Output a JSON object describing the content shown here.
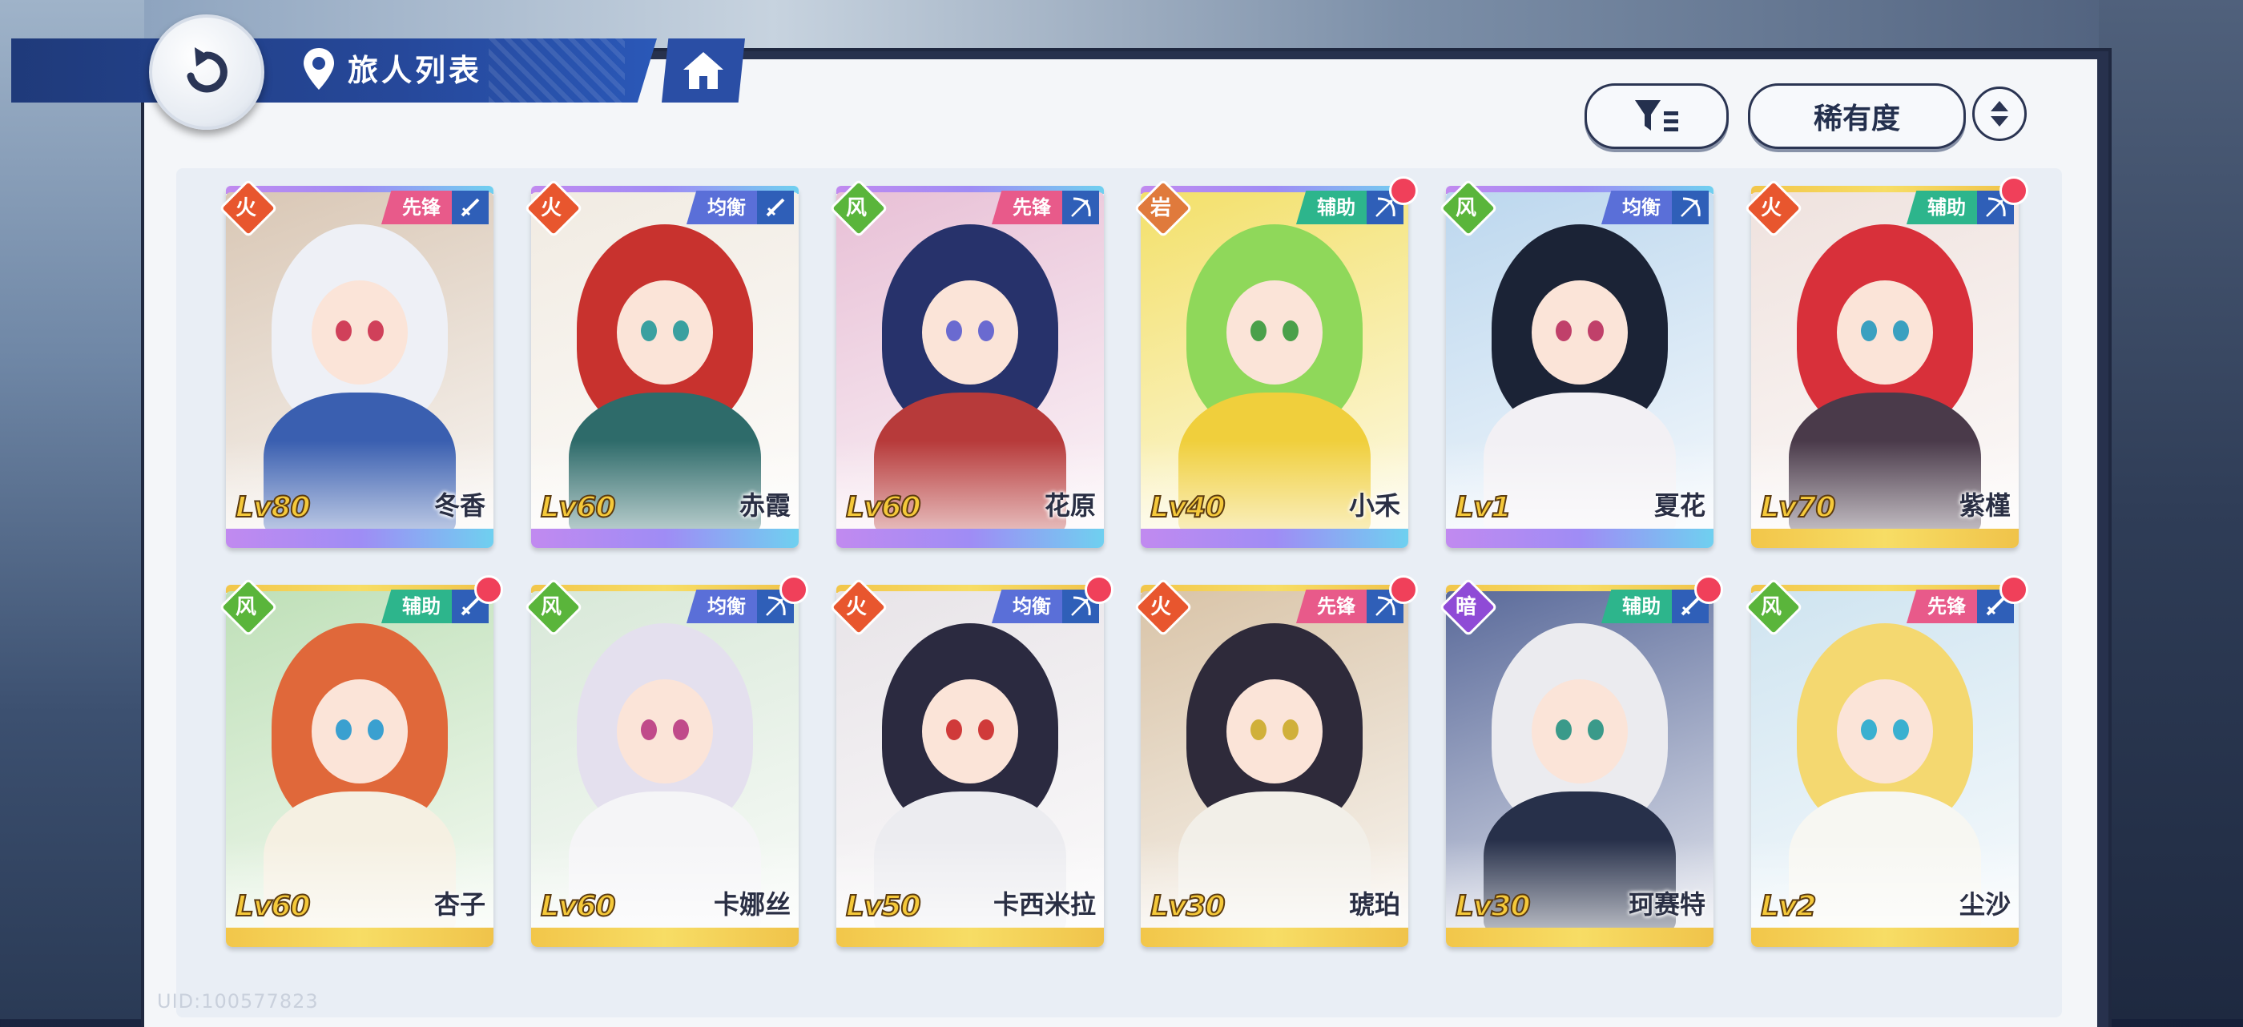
{
  "header": {
    "title": "旅人列表"
  },
  "controls": {
    "sort_label": "稀有度"
  },
  "colors": {
    "header_blue": "#26489a",
    "vanguard": "#e85a8a",
    "balance": "#5a6fd8",
    "support": "#2db58c",
    "level_gold": "#f5c93a"
  },
  "cards": [
    {
      "name": "冬香",
      "level": "Lv80",
      "role": "先锋",
      "element": "fire-icon",
      "weapon": "sword-icon",
      "rarity": "purple",
      "new": false,
      "hair": "#eef0f6",
      "outfit": "#3a5fb0",
      "eye": "#d0405a",
      "bg": "#d9c7b5"
    },
    {
      "name": "赤霞",
      "level": "Lv60",
      "role": "均衡",
      "element": "fire-icon",
      "weapon": "sword-icon",
      "rarity": "purple",
      "new": false,
      "hair": "#c8322e",
      "outfit": "#2e6b6a",
      "eye": "#3aa0a0",
      "bg": "#f1ebe2"
    },
    {
      "name": "花原",
      "level": "Lv60",
      "role": "先锋",
      "element": "wind-icon",
      "weapon": "bow-icon",
      "rarity": "purple",
      "new": false,
      "hair": "#27326b",
      "outfit": "#b73a3a",
      "eye": "#6a6ad0",
      "bg": "#e8c0d6"
    },
    {
      "name": "小禾",
      "level": "Lv40",
      "role": "辅助",
      "element": "earth-icon",
      "weapon": "bow-icon",
      "rarity": "purple",
      "new": true,
      "hair": "#8fd85a",
      "outfit": "#f0cf3c",
      "eye": "#4aa04a",
      "bg": "#f3e06a"
    },
    {
      "name": "夏花",
      "level": "Lv1",
      "role": "均衡",
      "element": "wind-icon",
      "weapon": "bow-icon",
      "rarity": "purple",
      "new": false,
      "hair": "#1b2336",
      "outfit": "#f2f0f4",
      "eye": "#c0406a",
      "bg": "#bcd7ee"
    },
    {
      "name": "紫槿",
      "level": "Lv70",
      "role": "辅助",
      "element": "fire-icon",
      "weapon": "bow-icon",
      "rarity": "gold",
      "new": true,
      "hair": "#d8303a",
      "outfit": "#4a3a4a",
      "eye": "#3aa0c0",
      "bg": "#efe2de"
    },
    {
      "name": "杏子",
      "level": "Lv60",
      "role": "辅助",
      "element": "wind-icon",
      "weapon": "sword-icon",
      "rarity": "gold",
      "new": true,
      "hair": "#e0683a",
      "outfit": "#f5f0e2",
      "eye": "#3aa0d0",
      "bg": "#bfe0b8"
    },
    {
      "name": "卡娜丝",
      "level": "Lv60",
      "role": "均衡",
      "element": "wind-icon",
      "weapon": "bow-icon",
      "rarity": "gold",
      "new": true,
      "hair": "#e4e0ee",
      "outfit": "#f5f5f7",
      "eye": "#c04a8a",
      "bg": "#d8e8d8"
    },
    {
      "name": "卡西米拉",
      "level": "Lv50",
      "role": "均衡",
      "element": "fire-icon",
      "weapon": "bow-icon",
      "rarity": "gold",
      "new": true,
      "hair": "#2b2a40",
      "outfit": "#ececf0",
      "eye": "#d03a3a",
      "bg": "#e8e4e8"
    },
    {
      "name": "琥珀",
      "level": "Lv30",
      "role": "先锋",
      "element": "fire-icon",
      "weapon": "bow-icon",
      "rarity": "gold",
      "new": true,
      "hair": "#2e2a3a",
      "outfit": "#f2efe8",
      "eye": "#d0b03a",
      "bg": "#d9c4a8"
    },
    {
      "name": "珂赛特",
      "level": "Lv30",
      "role": "辅助",
      "element": "dark-icon",
      "weapon": "sword-icon",
      "rarity": "gold",
      "new": true,
      "hair": "#ebebef",
      "outfit": "#27304a",
      "eye": "#3a9a8a",
      "bg": "#5a6a9a"
    },
    {
      "name": "尘沙",
      "level": "Lv2",
      "role": "先锋",
      "element": "wind-icon",
      "weapon": "sword-icon",
      "rarity": "gold",
      "new": true,
      "hair": "#f4d870",
      "outfit": "#f7f7f2",
      "eye": "#3ab0d0",
      "bg": "#cfe4f0"
    }
  ],
  "footer": {
    "uid": "UID:100577823"
  }
}
